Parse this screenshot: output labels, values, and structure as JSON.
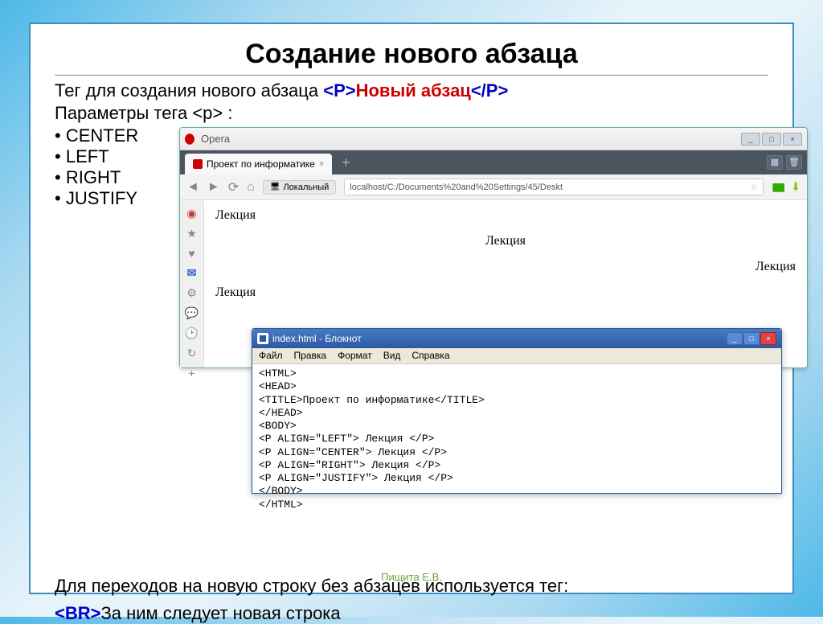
{
  "slide": {
    "title": "Создание нового абзаца",
    "intro_pre": "Тег  для создания нового абзаца  ",
    "tag_open": "<P>",
    "tag_text": "Новый абзац",
    "tag_close": "</P>",
    "params_label": "Параметры тега <p> :",
    "bullets": [
      "CENTER",
      "LEFT",
      "RIGHT",
      "JUSTIFY"
    ],
    "footer1": "Для переходов на новую строку без абзацев используется тег:",
    "footer_tag": "<BR>",
    "footer2": "За ним следует новая строка",
    "author": "Пищита Е.В."
  },
  "opera": {
    "app_title": "Opera",
    "tab_label": "Проект по информатике",
    "addr_mode": "Локальный",
    "url": "localhost/C:/Documents%20and%20Settings/45/Deskt",
    "page": {
      "line1": "Лекция",
      "line2": "Лекция",
      "line3": "Лекция",
      "line4": "Лекция"
    },
    "side_icons": [
      "opera",
      "star",
      "heart",
      "mail",
      "gear",
      "chat",
      "clock",
      "refresh",
      "plus"
    ]
  },
  "notepad": {
    "title": "index.html - Блокнот",
    "menu": [
      "Файл",
      "Правка",
      "Формат",
      "Вид",
      "Справка"
    ],
    "content": "<HTML>\n<HEAD>\n<TITLE>Проект по информатике</TITLE>\n</HEAD>\n<BODY>\n<P ALIGN=\"LEFT\"> Лекция </P>\n<P ALIGN=\"CENTER\"> Лекция </P>\n<P ALIGN=\"RIGHT\"> Лекция </P>\n<P ALIGN=\"JUSTIFY\"> Лекция </P>\n</BODY>\n</HTML>"
  }
}
